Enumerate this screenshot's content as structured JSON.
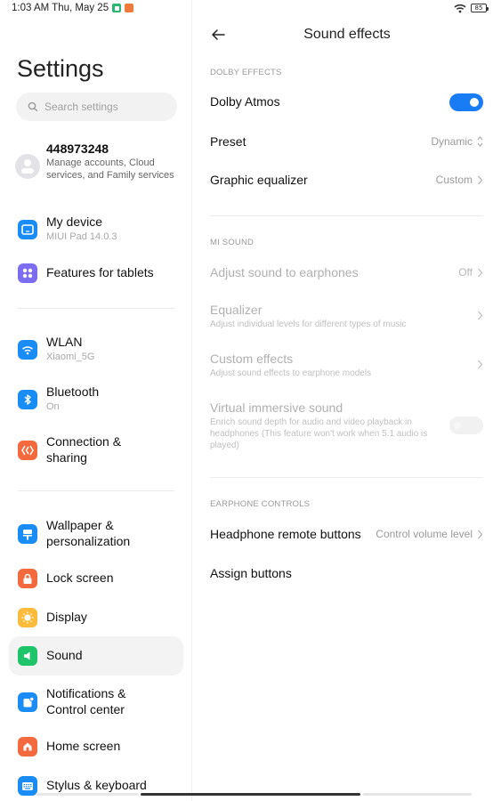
{
  "status_bar": {
    "time_date": "1:03 AM Thu, May 25",
    "battery_level": "85"
  },
  "sidebar": {
    "title": "Settings",
    "search_placeholder": "Search settings",
    "account": {
      "id": "448973248",
      "subtitle": "Manage accounts, Cloud services, and Family services"
    },
    "items": [
      {
        "label": "My device",
        "sub": "MIUI Pad 14.0.3",
        "icon": "device-icon",
        "color": "#1a8cf5"
      },
      {
        "label": "Features for tablets",
        "sub": "",
        "icon": "grid-icon",
        "color": "#7b6cf0"
      },
      {
        "label": "WLAN",
        "sub": "Xiaomi_5G",
        "icon": "wifi-icon",
        "color": "#1a8cf5"
      },
      {
        "label": "Bluetooth",
        "sub": "On",
        "icon": "bluetooth-icon",
        "color": "#1a8cf5"
      },
      {
        "label": "Connection & sharing",
        "sub": "",
        "icon": "connection-icon",
        "color": "#f26a3d"
      },
      {
        "label": "Wallpaper & personalization",
        "sub": "",
        "icon": "wallpaper-icon",
        "color": "#1a8cf5"
      },
      {
        "label": "Lock screen",
        "sub": "",
        "icon": "lock-icon",
        "color": "#f26a3d"
      },
      {
        "label": "Display",
        "sub": "",
        "icon": "sun-icon",
        "color": "#fbbb3c"
      },
      {
        "label": "Sound",
        "sub": "",
        "icon": "speaker-icon",
        "color": "#1ec46a",
        "selected": true
      },
      {
        "label": "Notifications & Control center",
        "sub": "",
        "icon": "notification-icon",
        "color": "#1a8cf5"
      },
      {
        "label": "Home screen",
        "sub": "",
        "icon": "home-icon",
        "color": "#f26a3d"
      },
      {
        "label": "Stylus & keyboard",
        "sub": "",
        "icon": "keyboard-icon",
        "color": "#1a8cf5"
      }
    ]
  },
  "detail": {
    "title": "Sound effects",
    "sections": [
      {
        "header": "DOLBY EFFECTS",
        "rows": [
          {
            "label": "Dolby Atmos",
            "type": "toggle",
            "value": true
          },
          {
            "label": "Preset",
            "value": "Dynamic",
            "type": "select"
          },
          {
            "label": "Graphic equalizer",
            "value": "Custom",
            "type": "link"
          }
        ]
      },
      {
        "header": "MI SOUND",
        "rows": [
          {
            "label": "Adjust sound to earphones",
            "value": "Off",
            "type": "link",
            "disabled": true
          },
          {
            "label": "Equalizer",
            "sub": "Adjust individual levels for different types of music",
            "type": "link",
            "disabled": true
          },
          {
            "label": "Custom effects",
            "sub": "Adjust sound effects to earphone models",
            "type": "link",
            "disabled": true
          },
          {
            "label": "Virtual immersive sound",
            "sub": "Enrich sound depth for audio and video playback in headphones (This feature won't work when 5.1 audio is played)",
            "type": "toggle",
            "value": false,
            "disabled": true
          }
        ]
      },
      {
        "header": "EARPHONE CONTROLS",
        "rows": [
          {
            "label": "Headphone remote buttons",
            "value": "Control volume level",
            "type": "link"
          },
          {
            "label": "Assign buttons",
            "type": "link"
          }
        ]
      }
    ]
  }
}
